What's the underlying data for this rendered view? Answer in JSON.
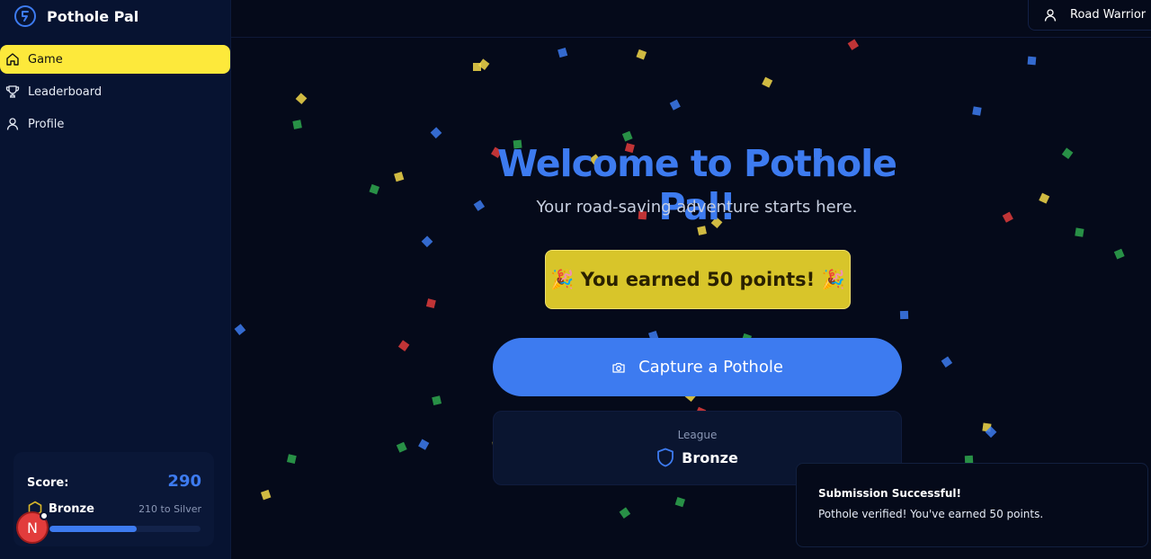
{
  "app": {
    "name": "Pothole Pal"
  },
  "sidebar": {
    "items": [
      {
        "label": "Game",
        "icon": "home-icon",
        "active": true
      },
      {
        "label": "Leaderboard",
        "icon": "trophy-icon",
        "active": false
      },
      {
        "label": "Profile",
        "icon": "user-icon",
        "active": false
      }
    ]
  },
  "score_card": {
    "label": "Score:",
    "value": "290",
    "league": "Bronze",
    "to_next": "210 to Silver",
    "progress_fraction": 0.58
  },
  "user": {
    "name": "Road Warrior"
  },
  "hero": {
    "title": "Welcome to Pothole Pal!",
    "subtitle": "Your road-saving adventure starts here."
  },
  "banner": {
    "text": "🎉 You earned 50 points! 🎉"
  },
  "capture": {
    "label": "Capture a Pothole"
  },
  "league_card": {
    "label": "League",
    "value": "Bronze"
  },
  "toast": {
    "title": "Submission Successful!",
    "message": "Pothole verified! You've earned 50 points."
  },
  "avatar_badge": {
    "letter": "N"
  },
  "colors": {
    "accent": "#3d7bf0",
    "active_nav": "#fde93b",
    "banner": "#d8c52a",
    "background": "#050a1a",
    "sidebar": "#071331"
  }
}
